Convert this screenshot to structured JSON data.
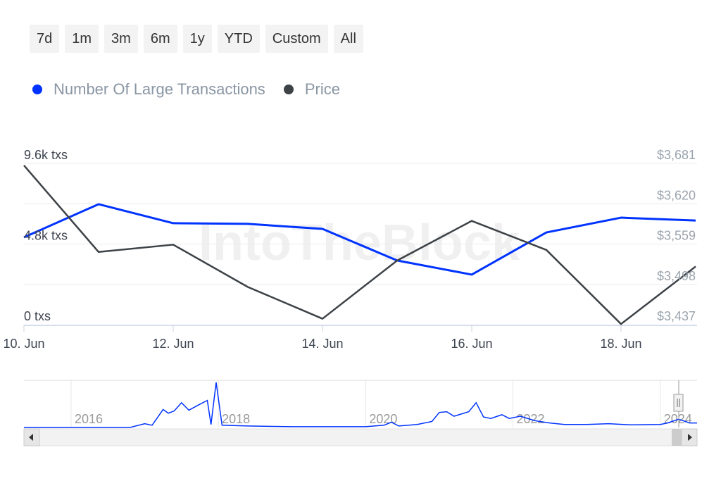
{
  "range_buttons": [
    "7d",
    "1m",
    "3m",
    "6m",
    "1y",
    "YTD",
    "Custom",
    "All"
  ],
  "watermark": "IntoTheBlock",
  "chart_data": {
    "type": "line",
    "categories": [
      "10. Jun",
      "11. Jun",
      "12. Jun",
      "13. Jun",
      "14. Jun",
      "15. Jun",
      "16. Jun",
      "17. Jun",
      "18. Jun",
      "19. Jun"
    ],
    "x_tick_labels": [
      "10. Jun",
      "12. Jun",
      "14. Jun",
      "16. Jun",
      "18. Jun"
    ],
    "series": [
      {
        "name": "Number Of Large Transactions",
        "axis": "left",
        "color": "#0033ff",
        "values": [
          5200,
          7170,
          6040,
          6000,
          5700,
          3820,
          2980,
          5490,
          6370,
          6200
        ]
      },
      {
        "name": "Price",
        "axis": "right",
        "color": "#3d4247",
        "values": [
          3678,
          3547,
          3558,
          3494,
          3446,
          3534,
          3594,
          3550,
          3438,
          3525
        ]
      }
    ],
    "left_axis": {
      "ticks": [
        "0 txs",
        "4.8k txs",
        "9.6k txs"
      ],
      "ylim": [
        0,
        9600
      ]
    },
    "right_axis": {
      "ticks": [
        "$3,437",
        "$3,498",
        "$3,559",
        "$3,620",
        "$3,681"
      ],
      "ylim": [
        3437,
        3681
      ]
    },
    "grid": true,
    "legend": "top-left",
    "navigator": {
      "year_labels": [
        "2016",
        "2018",
        "2020",
        "2022",
        "2024"
      ],
      "xlim": [
        2015.36,
        2024.5
      ],
      "series_color": "#0033ff",
      "points": [
        [
          2015.36,
          0
        ],
        [
          2016.8,
          0
        ],
        [
          2017.0,
          5000
        ],
        [
          2017.1,
          3000
        ],
        [
          2017.25,
          24000
        ],
        [
          2017.32,
          19000
        ],
        [
          2017.4,
          22000
        ],
        [
          2017.5,
          33000
        ],
        [
          2017.6,
          23000
        ],
        [
          2017.75,
          31000
        ],
        [
          2017.85,
          36000
        ],
        [
          2017.9,
          4000
        ],
        [
          2017.97,
          60000
        ],
        [
          2018.05,
          3000
        ],
        [
          2018.4,
          2000
        ],
        [
          2019.0,
          1000
        ],
        [
          2020.0,
          1000
        ],
        [
          2020.25,
          3000
        ],
        [
          2020.35,
          7000
        ],
        [
          2020.45,
          2000
        ],
        [
          2020.7,
          4000
        ],
        [
          2020.9,
          8000
        ],
        [
          2021.0,
          20000
        ],
        [
          2021.1,
          21000
        ],
        [
          2021.2,
          15000
        ],
        [
          2021.4,
          21000
        ],
        [
          2021.5,
          33000
        ],
        [
          2021.6,
          14000
        ],
        [
          2021.7,
          12000
        ],
        [
          2021.85,
          17000
        ],
        [
          2021.95,
          12000
        ],
        [
          2022.1,
          15000
        ],
        [
          2022.3,
          9000
        ],
        [
          2022.5,
          6000
        ],
        [
          2022.7,
          4000
        ],
        [
          2023.0,
          4000
        ],
        [
          2023.3,
          5000
        ],
        [
          2023.6,
          3500
        ],
        [
          2024.0,
          4000
        ],
        [
          2024.1,
          6000
        ],
        [
          2024.25,
          11000
        ],
        [
          2024.4,
          6000
        ],
        [
          2024.5,
          6000
        ]
      ]
    }
  }
}
